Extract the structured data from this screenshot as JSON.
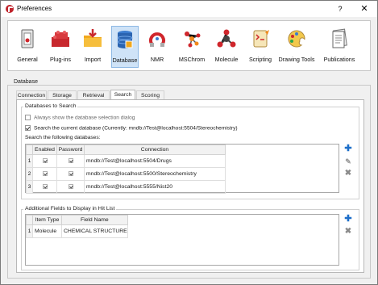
{
  "window": {
    "title": "Preferences",
    "help_label": "?",
    "close_label": "✕"
  },
  "toolbar": {
    "items": [
      {
        "label": "General",
        "icon": "general-switch-icon"
      },
      {
        "label": "Plug-ins",
        "icon": "plugins-bricks-icon"
      },
      {
        "label": "Import",
        "icon": "import-folder-icon"
      },
      {
        "label": "Database",
        "icon": "database-icon",
        "active": true
      },
      {
        "label": "NMR",
        "icon": "nmr-magnet-icon"
      },
      {
        "label": "MSChrom",
        "icon": "mschrom-molecule-icon"
      },
      {
        "label": "Molecule",
        "icon": "molecule-icon"
      },
      {
        "label": "Scripting",
        "icon": "scripting-scroll-icon"
      },
      {
        "label": "Drawing Tools",
        "icon": "drawing-palette-icon"
      },
      {
        "label": "Publications",
        "icon": "publications-document-icon"
      }
    ]
  },
  "database_group": {
    "title": "Database"
  },
  "tabs": [
    "Connection",
    "Storage",
    "Retrieval",
    "Search",
    "Scoring"
  ],
  "active_tab": "Search",
  "search_section": {
    "title": "Databases to Search",
    "always_show_label": "Always show the database selection dialog",
    "always_show_checked": false,
    "search_current_label": "Search the current database (Currently: mndb://Test@localhost:5504/Stereochemistry)",
    "search_current_checked": true,
    "following_label": "Search the following databases:",
    "columns": [
      "Enabled",
      "Password",
      "Connection"
    ],
    "rows": [
      {
        "num": "1",
        "enabled": true,
        "password": true,
        "connection": "mndb://Test@localhost:5504/Drugs"
      },
      {
        "num": "2",
        "enabled": true,
        "password": true,
        "connection": "mndb://Test@localhost:5500/Stereochemistry"
      },
      {
        "num": "3",
        "enabled": true,
        "password": true,
        "connection": "mndb://Test@localhost:5555/Nist20"
      }
    ]
  },
  "hitlist_section": {
    "title": "Additional Fields to Display in Hit List",
    "columns": [
      "Item Type",
      "Field Name"
    ],
    "rows": [
      {
        "num": "1",
        "item_type": "Molecule",
        "field_name": "CHEMICAL STRUCTURE"
      }
    ]
  },
  "colors": {
    "accent": "#1e6fc9",
    "active_tool_bg": "#cfe3f7",
    "app_icon": "#c0242c"
  }
}
